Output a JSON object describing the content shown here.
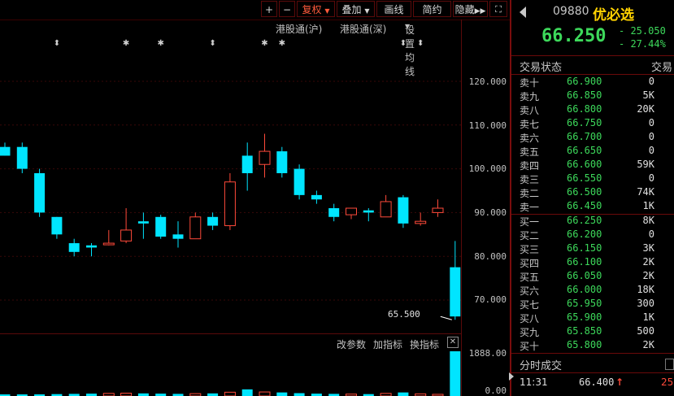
{
  "toolbar": {
    "plus": "+",
    "minus": "−",
    "fuquan": "复权",
    "diejia": "叠加",
    "huaxian": "画线",
    "jianyue": "简约",
    "yincang": "隐藏",
    "arrows": "▶▶",
    "expand": "⛶"
  },
  "link_bar": {
    "sh": "港股通(沪)",
    "sz": "港股通(深)",
    "ma_setting": "设置均线"
  },
  "price_axis": [
    "120.000",
    "110.000",
    "100.000",
    "90.000",
    "80.000",
    "70.000"
  ],
  "low_label": "65.500",
  "indicator_bar": {
    "edit_params": "改参数",
    "add_indicator": "加指标",
    "change_indicator": "换指标",
    "close": "✕"
  },
  "volume_axis": [
    "1888.00",
    "0.00"
  ],
  "chart_data": {
    "type": "candlestick",
    "ylim": [
      62,
      125
    ],
    "colors": {
      "up": "#ff4a3a",
      "down": "#00e5ff"
    },
    "candles": [
      {
        "o": 105,
        "h": 106,
        "l": 103,
        "c": 103
      },
      {
        "o": 105,
        "h": 106,
        "l": 99,
        "c": 100
      },
      {
        "o": 99,
        "h": 100,
        "l": 89,
        "c": 90
      },
      {
        "o": 89,
        "h": 89,
        "l": 84,
        "c": 85
      },
      {
        "o": 83,
        "h": 84,
        "l": 80,
        "c": 81
      },
      {
        "o": 82.5,
        "h": 83,
        "l": 80,
        "c": 82
      },
      {
        "o": 83,
        "h": 86,
        "l": 82.5,
        "c": 83
      },
      {
        "o": 83.5,
        "h": 91,
        "l": 83,
        "c": 86
      },
      {
        "o": 88,
        "h": 90,
        "l": 84,
        "c": 87.5
      },
      {
        "o": 89,
        "h": 89.5,
        "l": 84,
        "c": 84.5
      },
      {
        "o": 85,
        "h": 88,
        "l": 82,
        "c": 84
      },
      {
        "o": 84,
        "h": 90,
        "l": 84,
        "c": 89
      },
      {
        "o": 89,
        "h": 90,
        "l": 86,
        "c": 87
      },
      {
        "o": 87,
        "h": 99,
        "l": 86,
        "c": 97
      },
      {
        "o": 103,
        "h": 106,
        "l": 95,
        "c": 99
      },
      {
        "o": 101,
        "h": 108,
        "l": 98,
        "c": 104
      },
      {
        "o": 104,
        "h": 105,
        "l": 98,
        "c": 99
      },
      {
        "o": 100,
        "h": 101,
        "l": 93,
        "c": 94
      },
      {
        "o": 94,
        "h": 95,
        "l": 92,
        "c": 93
      },
      {
        "o": 91,
        "h": 92,
        "l": 88,
        "c": 89
      },
      {
        "o": 89.5,
        "h": 91,
        "l": 88.5,
        "c": 91
      },
      {
        "o": 90.5,
        "h": 91,
        "l": 88,
        "c": 90
      },
      {
        "o": 89,
        "h": 94,
        "l": 89,
        "c": 92.5
      },
      {
        "o": 93.5,
        "h": 94,
        "l": 86.5,
        "c": 87.5
      },
      {
        "o": 87.5,
        "h": 90,
        "l": 87,
        "c": 88
      },
      {
        "o": 90,
        "h": 93,
        "l": 89,
        "c": 91
      },
      {
        "o": 77.5,
        "h": 83.5,
        "l": 65.5,
        "c": 66.25
      }
    ],
    "volumes": [
      40,
      60,
      70,
      80,
      90,
      100,
      110,
      120,
      110,
      100,
      90,
      100,
      110,
      160,
      280,
      170,
      150,
      120,
      100,
      90,
      80,
      80,
      110,
      150,
      90,
      70,
      1888
    ],
    "marker_days": [
      3,
      7,
      9,
      12,
      15,
      16,
      23,
      24
    ],
    "marker_symbols": [
      "⬍",
      "✱",
      "✱",
      "⬍",
      "✱",
      "✱",
      "⬍",
      "⬍"
    ]
  },
  "quote": {
    "code": "09880",
    "name": "优必选",
    "price": "66.250",
    "change": "- 25.050",
    "change_pct": "- 27.44%",
    "status_label": "交易状态",
    "status_value": "交易"
  },
  "order_book": {
    "asks": [
      {
        "label": "卖十",
        "price": "66.900",
        "vol": "0"
      },
      {
        "label": "卖九",
        "price": "66.850",
        "vol": "5K"
      },
      {
        "label": "卖八",
        "price": "66.800",
        "vol": "20K"
      },
      {
        "label": "卖七",
        "price": "66.750",
        "vol": "0"
      },
      {
        "label": "卖六",
        "price": "66.700",
        "vol": "0"
      },
      {
        "label": "卖五",
        "price": "66.650",
        "vol": "0"
      },
      {
        "label": "卖四",
        "price": "66.600",
        "vol": "59K"
      },
      {
        "label": "卖三",
        "price": "66.550",
        "vol": "0"
      },
      {
        "label": "卖二",
        "price": "66.500",
        "vol": "74K"
      },
      {
        "label": "卖一",
        "price": "66.450",
        "vol": "1K"
      }
    ],
    "bids": [
      {
        "label": "买一",
        "price": "66.250",
        "vol": "8K"
      },
      {
        "label": "买二",
        "price": "66.200",
        "vol": "0"
      },
      {
        "label": "买三",
        "price": "66.150",
        "vol": "3K"
      },
      {
        "label": "买四",
        "price": "66.100",
        "vol": "2K"
      },
      {
        "label": "买五",
        "price": "66.050",
        "vol": "2K"
      },
      {
        "label": "买六",
        "price": "66.000",
        "vol": "18K"
      },
      {
        "label": "买七",
        "price": "65.950",
        "vol": "300"
      },
      {
        "label": "买八",
        "price": "65.900",
        "vol": "1K"
      },
      {
        "label": "买九",
        "price": "65.850",
        "vol": "500"
      },
      {
        "label": "买十",
        "price": "65.800",
        "vol": "2K"
      }
    ]
  },
  "ticks": {
    "header": "分时成交",
    "rows": [
      {
        "time": "11:31",
        "price": "66.400",
        "arrow": "↑",
        "vol": "25"
      }
    ]
  }
}
